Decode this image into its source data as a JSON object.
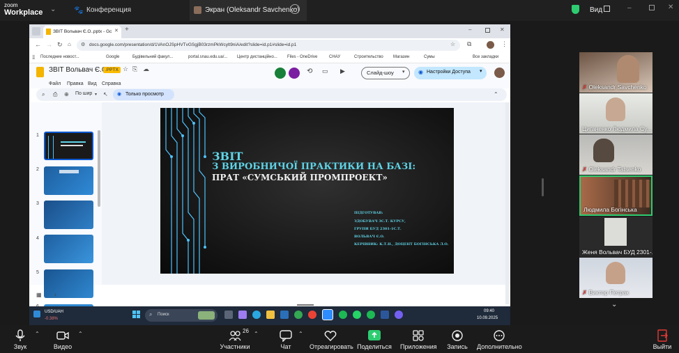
{
  "zoom": {
    "logo_line1": "zoom",
    "logo_line2": "Workplace",
    "tabs": [
      {
        "label": "Конференция"
      },
      {
        "label": "Экран (Oleksandr Savchenko)"
      }
    ],
    "view_label": "Вид",
    "participants_count": "26",
    "toolbar": {
      "audio": "Звук",
      "video": "Видео",
      "participants": "Участники",
      "chat": "Чат",
      "react": "Отреагировать",
      "share": "Поделиться",
      "apps": "Приложения",
      "record": "Запись",
      "more": "Дополнительно",
      "leave": "Выйти"
    },
    "participants": [
      {
        "name": "Oleksandr Savchenko",
        "muted": true
      },
      {
        "name": "Циганенко Людмила Су...",
        "muted": false
      },
      {
        "name": "Oleksandr Tatsenko",
        "muted": true
      },
      {
        "name": "Людмила Богінська",
        "muted": false,
        "active": true
      },
      {
        "name": "Женя Вольвач БУД 2301-...",
        "muted": false
      },
      {
        "name": "Виктор Петрак",
        "muted": true
      }
    ]
  },
  "browser": {
    "tab_title": "ЗВІТ Вольвач Є.О..pptx - Goog",
    "url": "docs.google.com/presentation/d/1VAnOJSpHVTvGSgjB03rzmPkWcylt9niA/edit?slide=id.p1#slide=id.p1",
    "bookmarks": [
      "Последние новост...",
      "Google",
      "Будівельний факул...",
      "portal.snau.edu.ua/...",
      "Центр дистанційно...",
      "Files - OneDrive",
      "СНАУ",
      "Строительство",
      "Магазин",
      "Сумы"
    ],
    "all_bookmarks": "Все закладки"
  },
  "slides": {
    "doc_title": "ЗВІТ Вольвач Є.О.",
    "badge": ".PPTX",
    "menu": [
      "Файл",
      "Правка",
      "Вид",
      "Справка"
    ],
    "slideshow_btn": "Слайд-шоу",
    "access_btn": "Настройки Доступа",
    "zoom_label": "По шир",
    "view_only": "Только просмотр",
    "thumb_numbers": [
      "1",
      "2",
      "3",
      "4",
      "5",
      "6"
    ],
    "main_slide": {
      "title_line1": "ЗВІТ",
      "title_line2": "З ВИРОБНИЧОЇ ПРАКТИКИ НА БАЗІ:",
      "title_line3": "ПРАТ «СУМСЬКИЙ ПРОМПРОЕКТ»",
      "prepared_label": "ПІДГОТУВАВ:",
      "lines": [
        "ЗДОБУВАЧ 3С.Т. КУРСУ,",
        "ГРУПИ БУД 2301-1С.Т.",
        "ВОЛЬВАЧ Є.О.",
        "КЕРІВНИК: К.Т.Н., ДОЦЕНТ БОГІНСЬКА Л.О."
      ]
    }
  },
  "taskbar": {
    "ticker": "USD/UAH",
    "change": "-0.38%",
    "search": "Поиск",
    "time": "09:40",
    "date": "10.09.2025"
  },
  "colors": {
    "zoom_bg": "#1b1b1b",
    "accent_blue": "#0b57d0",
    "slide_title_cyan": "#5fd3e6",
    "active_border": "#2ecc71",
    "leave_red": "#e53935"
  }
}
